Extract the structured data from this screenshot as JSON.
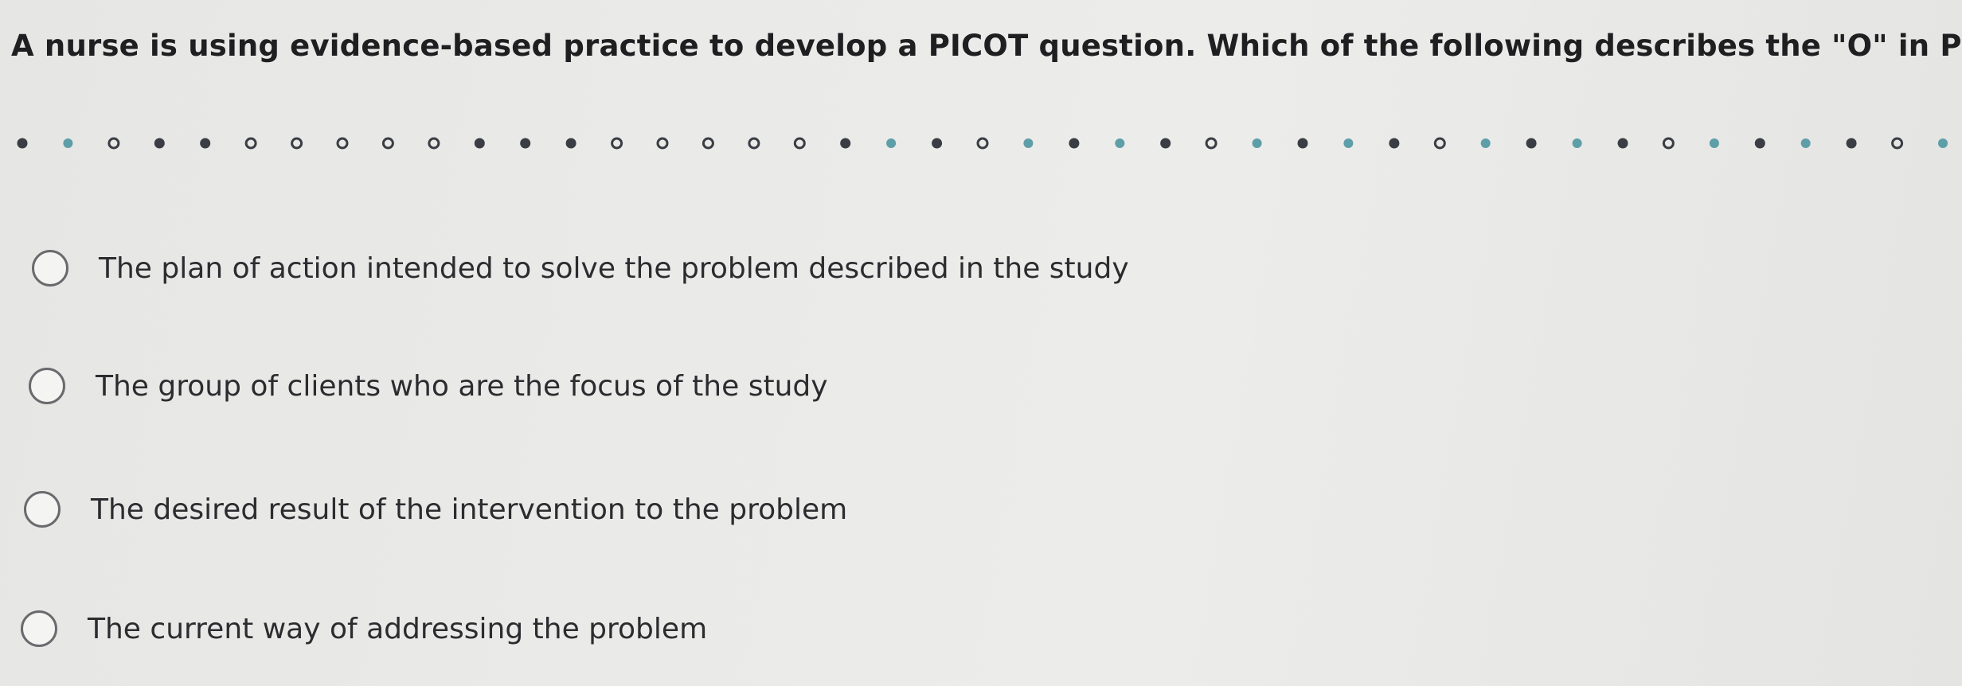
{
  "question": {
    "text": "A nurse is using evidence-based practice to develop a PICOT question. Which of the following describes the \"O\" in PICOT?"
  },
  "progress": {
    "dots": [
      {
        "state": "filled",
        "color": "#3a3d44"
      },
      {
        "state": "current",
        "color": "#5e9ea8"
      },
      {
        "state": "ring",
        "color": "#3a3d44"
      },
      {
        "state": "filled",
        "color": "#3a3d44"
      },
      {
        "state": "filled",
        "color": "#3a3d44"
      },
      {
        "state": "ring",
        "color": "#3a3d44"
      },
      {
        "state": "ring",
        "color": "#3a3d44"
      },
      {
        "state": "ring",
        "color": "#3a3d44"
      },
      {
        "state": "ring",
        "color": "#3a3d44"
      },
      {
        "state": "ring",
        "color": "#3a3d44"
      },
      {
        "state": "filled",
        "color": "#3a3d44"
      },
      {
        "state": "filled",
        "color": "#3a3d44"
      },
      {
        "state": "filled",
        "color": "#3a3d44"
      },
      {
        "state": "ring",
        "color": "#3a3d44"
      },
      {
        "state": "ring",
        "color": "#3a3d44"
      },
      {
        "state": "ring",
        "color": "#3a3d44"
      },
      {
        "state": "ring",
        "color": "#3a3d44"
      },
      {
        "state": "ring",
        "color": "#3a3d44"
      },
      {
        "state": "filled",
        "color": "#3a3d44"
      },
      {
        "state": "current",
        "color": "#5e9ea8"
      },
      {
        "state": "filled",
        "color": "#3a3d44"
      },
      {
        "state": "ring",
        "color": "#3a3d44"
      },
      {
        "state": "current",
        "color": "#5e9ea8"
      },
      {
        "state": "filled",
        "color": "#3a3d44"
      },
      {
        "state": "current",
        "color": "#5e9ea8"
      },
      {
        "state": "filled",
        "color": "#3a3d44"
      },
      {
        "state": "ring",
        "color": "#3a3d44"
      },
      {
        "state": "current",
        "color": "#5e9ea8"
      },
      {
        "state": "filled",
        "color": "#3a3d44"
      },
      {
        "state": "current",
        "color": "#5e9ea8"
      },
      {
        "state": "filled",
        "color": "#3a3d44"
      },
      {
        "state": "ring",
        "color": "#3a3d44"
      },
      {
        "state": "current",
        "color": "#5e9ea8"
      },
      {
        "state": "filled",
        "color": "#3a3d44"
      },
      {
        "state": "current",
        "color": "#5e9ea8"
      },
      {
        "state": "filled",
        "color": "#3a3d44"
      },
      {
        "state": "ring",
        "color": "#3a3d44"
      },
      {
        "state": "current",
        "color": "#5e9ea8"
      },
      {
        "state": "filled",
        "color": "#3a3d44"
      },
      {
        "state": "current",
        "color": "#5e9ea8"
      },
      {
        "state": "filled",
        "color": "#3a3d44"
      },
      {
        "state": "ring",
        "color": "#3a3d44"
      },
      {
        "state": "current",
        "color": "#5e9ea8"
      }
    ]
  },
  "options": [
    {
      "label": "The plan of action intended to solve the problem described in the study",
      "selected": false
    },
    {
      "label": "The group of clients who are the focus of the study",
      "selected": false
    },
    {
      "label": "The desired result of the intervention to the problem",
      "selected": false
    },
    {
      "label": "The current way of addressing the problem",
      "selected": false
    }
  ]
}
